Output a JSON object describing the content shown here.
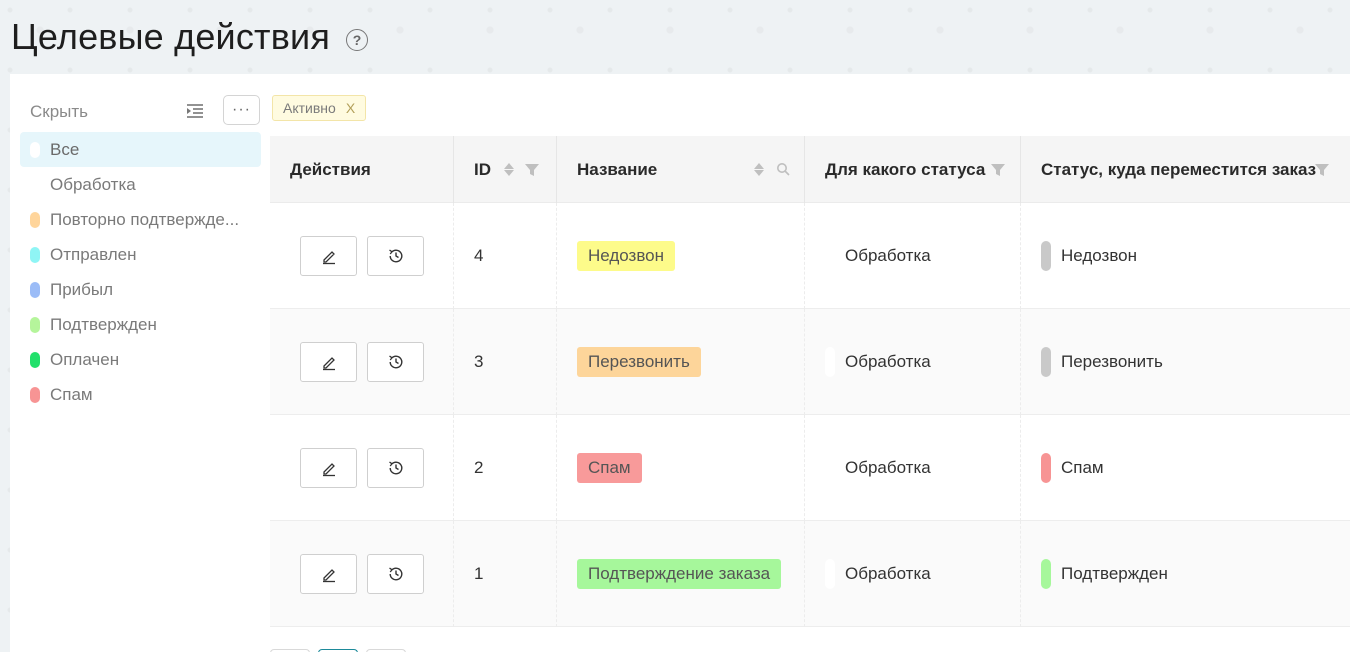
{
  "page": {
    "title": "Целевые действия"
  },
  "sidebar": {
    "hide_label": "Скрыть",
    "more_label": "···",
    "items": [
      {
        "label": "Все",
        "color": "#ffffff",
        "active": true
      },
      {
        "label": "Обработка",
        "color": "#ffffff",
        "active": false
      },
      {
        "label": "Повторно подтверждe...",
        "color": "#ffd59b",
        "active": false
      },
      {
        "label": "Отправлен",
        "color": "#8ff5f5",
        "active": false
      },
      {
        "label": "Прибыл",
        "color": "#9bbcf7",
        "active": false
      },
      {
        "label": "Подтвержден",
        "color": "#b5f59b",
        "active": false
      },
      {
        "label": "Оплачен",
        "color": "#22e06b",
        "active": false
      },
      {
        "label": "Спам",
        "color": "#f79494",
        "active": false
      }
    ]
  },
  "filter": {
    "label": "Активно",
    "close": "X"
  },
  "table": {
    "headers": {
      "actions": "Действия",
      "id": "ID",
      "name": "Название",
      "from_status": "Для какого статуса",
      "to_status": "Статус, куда переместится заказ"
    },
    "rows": [
      {
        "id": "4",
        "name": "Недозвон",
        "name_color": "#fdfb8a",
        "from": "Обработка",
        "from_color": "#ffffff",
        "to": "Недозвон",
        "to_color": "#c9c9c9"
      },
      {
        "id": "3",
        "name": "Перезвонить",
        "name_color": "#fdd59a",
        "from": "Обработка",
        "from_color": "#ffffff",
        "to": "Перезвонить",
        "to_color": "#c9c9c9"
      },
      {
        "id": "2",
        "name": "Спам",
        "name_color": "#f89a9a",
        "from": "Обработка",
        "from_color": "#ffffff",
        "to": "Спам",
        "to_color": "#f79494"
      },
      {
        "id": "1",
        "name": "Подтверждение заказа",
        "name_color": "#a6f79b",
        "from": "Обработка",
        "from_color": "#ffffff",
        "to": "Подтвержден",
        "to_color": "#a6f79b"
      }
    ]
  },
  "icons": {
    "help": "question-circle-icon",
    "collapse": "indent-icon",
    "edit": "pencil-icon",
    "history": "history-clock-icon",
    "sort": "sort-icon",
    "filter": "funnel-icon",
    "search": "search-icon"
  }
}
